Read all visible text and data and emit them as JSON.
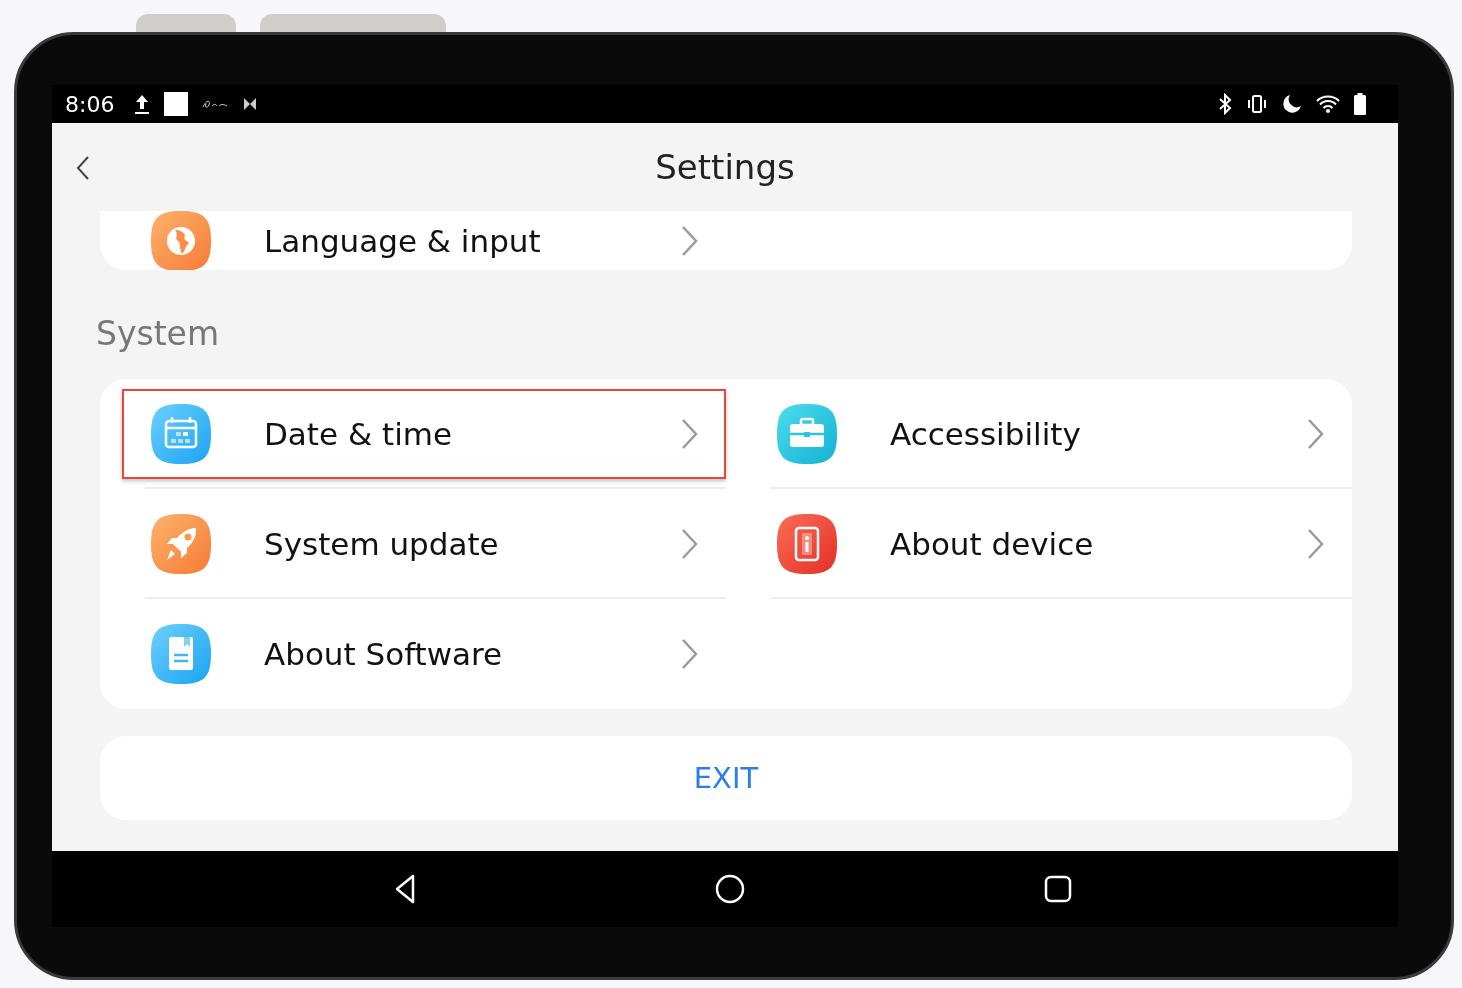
{
  "status_bar": {
    "time": "8:06"
  },
  "header": {
    "title": "Settings"
  },
  "top_card": {
    "items": [
      {
        "kind": "globe",
        "label": "Language & input",
        "selected": false
      }
    ]
  },
  "system_section": {
    "title": "System",
    "items": [
      {
        "kind": "calendar",
        "label": "Date & time",
        "selected": true
      },
      {
        "kind": "toolbox",
        "label": "Accessibility",
        "selected": false
      },
      {
        "kind": "rocket",
        "label": "System update",
        "selected": false
      },
      {
        "kind": "info",
        "label": "About device",
        "selected": false
      },
      {
        "kind": "document",
        "label": "About Software",
        "selected": false
      }
    ]
  },
  "exit_button": {
    "label": "EXIT"
  }
}
